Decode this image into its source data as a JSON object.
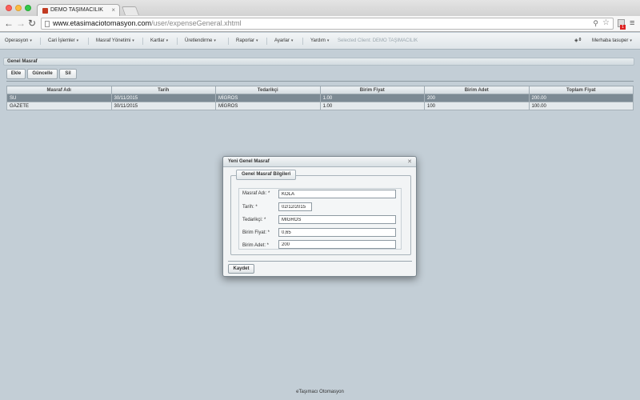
{
  "browser": {
    "tab_title": "DEMO TAŞIMACILIK",
    "url_host": "www.etasimaciotomasyon.com",
    "url_path": "/user/expenseGeneral.xhtml",
    "extension_badge": "1"
  },
  "menubar": {
    "items": [
      "Operasyon",
      "Cari İşlemler",
      "Masraf Yönetimi",
      "Kartlar",
      "Üretlendirme",
      "Raporlar",
      "Ayarlar",
      "Yardım"
    ],
    "selected_client": "Selected Client: DEMO TAŞIMACILIK",
    "notification_count": "0",
    "greeting": "Merhaba tasuper"
  },
  "panel": {
    "title": "Genel Masraf",
    "buttons": {
      "add": "Ekle",
      "update": "Güncelle",
      "delete": "Sil"
    }
  },
  "table": {
    "columns": [
      "Masraf Adı",
      "Tarih",
      "Tedarikçi",
      "Birim Fiyat",
      "Birim Adet",
      "Toplam Fiyat"
    ],
    "rows": [
      {
        "name": "SU",
        "date": "30/11/2015",
        "supplier": "MİGROS",
        "unit_price": "1.00",
        "unit_qty": "200",
        "total": "200.00",
        "selected": true
      },
      {
        "name": "GAZETE",
        "date": "30/11/2015",
        "supplier": "MİGROS",
        "unit_price": "1.00",
        "unit_qty": "100",
        "total": "100.00",
        "selected": false
      }
    ]
  },
  "dialog": {
    "title": "Yeni Genel Masraf",
    "legend": "Genel Masraf Bilgileri",
    "fields": {
      "name": {
        "label": "Masraf Adı: *",
        "value": "KOLA"
      },
      "date": {
        "label": "Tarih: *",
        "value": "02/12/2015"
      },
      "supplier": {
        "label": "Tedarikçi: *",
        "value": "MİGROS"
      },
      "unit_price": {
        "label": "Birim Fiyat: *",
        "value": "0,65"
      },
      "unit_qty": {
        "label": "Birim Adet: *",
        "value": "200"
      }
    },
    "save_label": "Kaydet"
  },
  "footer": "eTaşımacı Otomasyon",
  "colors": {
    "selected_row": "#7c8a94",
    "page_bg": "#c3ced6",
    "close_light": "#fc605c",
    "minimize_light": "#fdbc40",
    "zoom_light": "#34c84a"
  },
  "icons": [
    "back-icon",
    "forward-icon",
    "reload-icon",
    "page-icon",
    "zoom-icon",
    "star-icon",
    "menu-icon",
    "notification-icon",
    "close-icon"
  ]
}
